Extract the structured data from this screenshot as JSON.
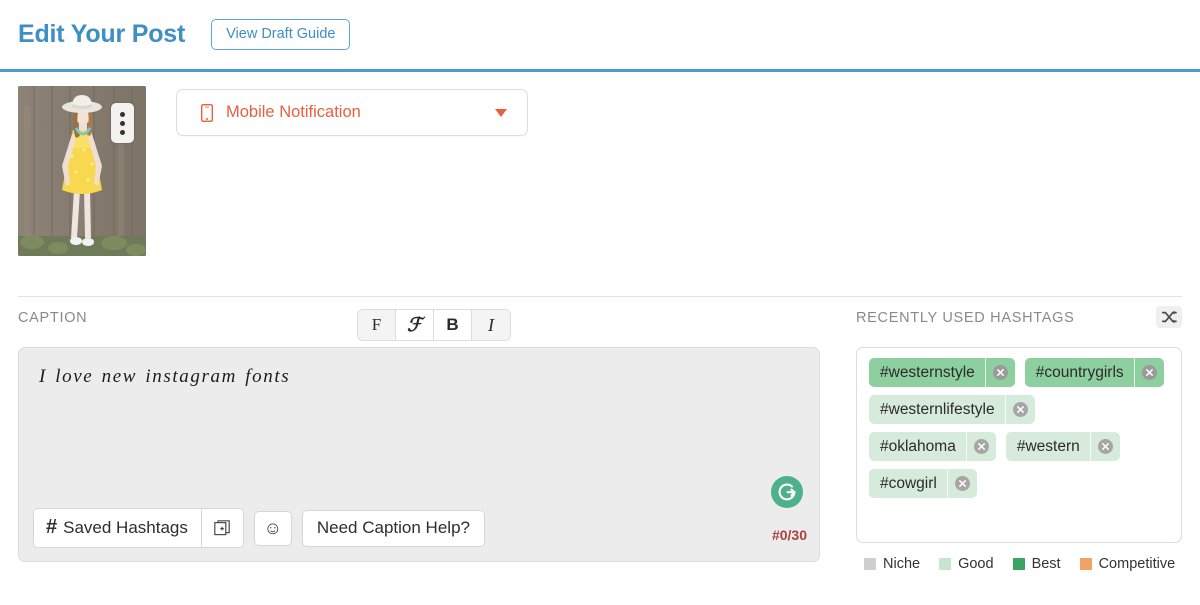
{
  "header": {
    "title": "Edit Your Post",
    "draft_guide_label": "View Draft Guide"
  },
  "post": {
    "thumbnail_alt": "Woman in yellow dress with white hat against wooden fence",
    "menu_icon": "kebab-menu-icon"
  },
  "notification": {
    "icon": "mobile-phone-icon",
    "selected": "Mobile Notification",
    "caret_icon": "chevron-down-icon",
    "accent_color": "#eb5f3f"
  },
  "caption": {
    "label": "CAPTION",
    "text": "I love new instagram fonts",
    "font_toolbar": [
      {
        "glyph": "F",
        "name": "font-serif-button",
        "active": false
      },
      {
        "glyph": "ℱ",
        "name": "font-script-button",
        "active": true
      },
      {
        "glyph": "B",
        "name": "font-bold-button",
        "active": true
      },
      {
        "glyph": "I",
        "name": "font-italic-button",
        "active": false
      }
    ],
    "saved_hashtags_label": "Saved Hashtags",
    "hash_symbol": "#",
    "add_collection_icon": "add-to-collection-icon",
    "emoji_icon": "☺",
    "caption_help_label": "Need Caption Help?",
    "grammarly_icon": "grammarly-g-icon",
    "hashtag_count": "#0/30",
    "count_color": "#a8423f"
  },
  "hashtags": {
    "label": "RECENTLY USED HASHTAGS",
    "shuffle_icon": "shuffle-icon",
    "chips": [
      {
        "label": "#westernstyle",
        "tier": "best",
        "color": "#8ecfa0"
      },
      {
        "label": "#countrygirls",
        "tier": "best",
        "color": "#8ecfa0"
      },
      {
        "label": "#westernlifestyle",
        "tier": "good",
        "color": "#d7ebdc"
      },
      {
        "label": "#oklahoma",
        "tier": "good",
        "color": "#d7ebdc"
      },
      {
        "label": "#western",
        "tier": "good",
        "color": "#d7ebdc"
      },
      {
        "label": "#cowgirl",
        "tier": "good",
        "color": "#d7ebdc"
      }
    ],
    "legend": [
      {
        "label": "Niche",
        "color": "#cfcfcf"
      },
      {
        "label": "Good",
        "color": "#c6e6d0"
      },
      {
        "label": "Best",
        "color": "#3aa563"
      },
      {
        "label": "Competitive",
        "color": "#f0a267"
      }
    ]
  }
}
